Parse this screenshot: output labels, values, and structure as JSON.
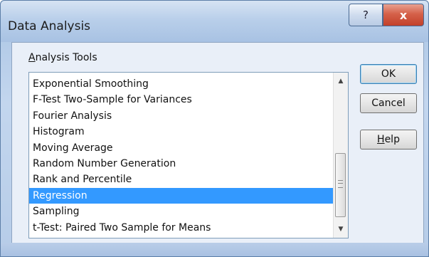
{
  "window": {
    "title": "Data Analysis",
    "help_glyph": "?",
    "close_glyph": "x"
  },
  "group": {
    "label_accel": "A",
    "label_rest": "nalysis Tools"
  },
  "list": {
    "items": [
      "Exponential Smoothing",
      "F-Test Two-Sample for Variances",
      "Fourier Analysis",
      "Histogram",
      "Moving Average",
      "Random Number Generation",
      "Rank and Percentile",
      "Regression",
      "Sampling",
      "t-Test: Paired Two Sample for Means"
    ],
    "selected": "Regression"
  },
  "buttons": {
    "ok": "OK",
    "cancel": "Cancel",
    "help_accel": "H",
    "help_rest": "elp"
  },
  "icons": {
    "scroll_up": "scroll-up-arrow-icon",
    "scroll_down": "scroll-down-arrow-icon",
    "grip": "scroll-thumb-grip-icon"
  },
  "colors": {
    "selection": "#3399ff",
    "close_button": "#c2402a",
    "title_bar": "#b9cfea"
  }
}
